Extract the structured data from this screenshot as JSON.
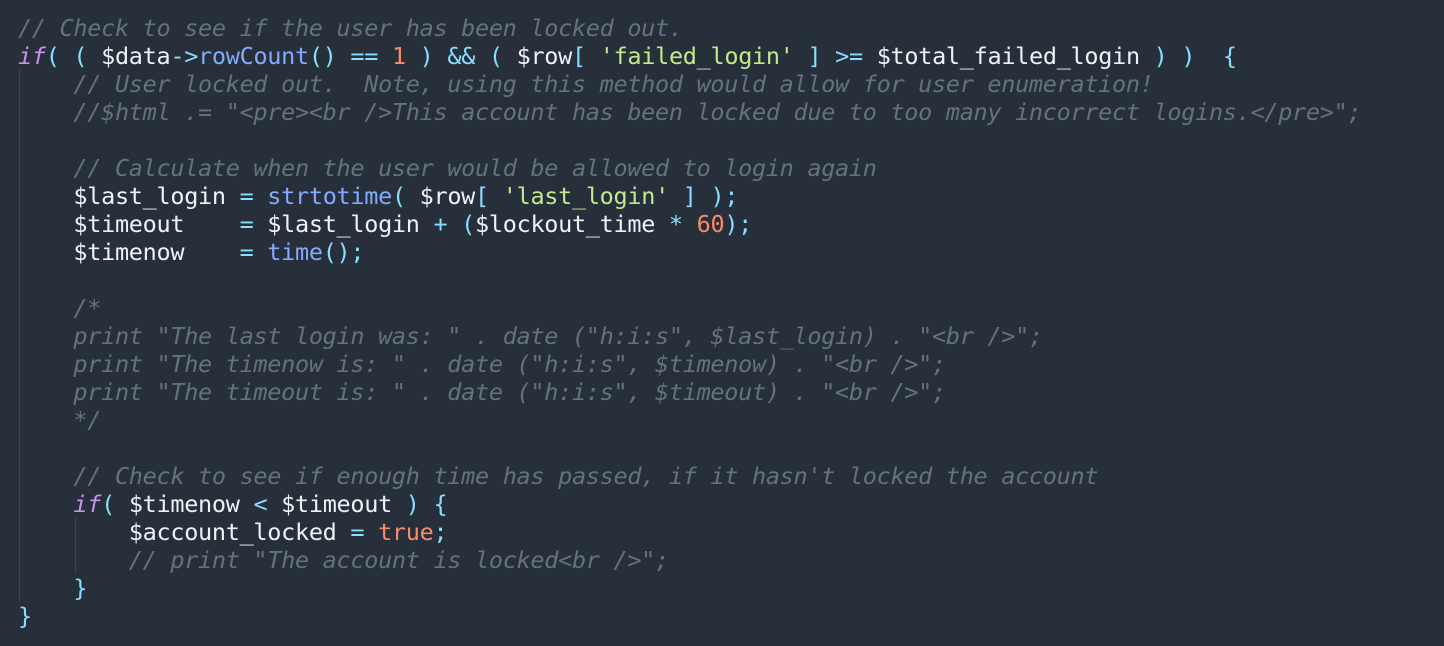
{
  "colors": {
    "background": "#27303a",
    "comment": "#63727f",
    "keyword": "#c792ea",
    "punctuation": "#89ddff",
    "variable": "#eef2f6",
    "function": "#82aaff",
    "number": "#f78c6c",
    "string": "#c3e88d",
    "boolean": "#f78c6c",
    "indent_guide": "#3a4552"
  },
  "code": {
    "lines": [
      {
        "indent": 0,
        "tokens": [
          {
            "t": "comment",
            "v": "// Check to see if the user has been locked out."
          }
        ]
      },
      {
        "indent": 0,
        "tokens": [
          {
            "t": "keyword",
            "v": "if"
          },
          {
            "t": "punct",
            "v": "( ( "
          },
          {
            "t": "var",
            "v": "$data"
          },
          {
            "t": "punct",
            "v": "->"
          },
          {
            "t": "func",
            "v": "rowCount"
          },
          {
            "t": "punct",
            "v": "() == "
          },
          {
            "t": "number",
            "v": "1"
          },
          {
            "t": "punct",
            "v": " ) && ( "
          },
          {
            "t": "var",
            "v": "$row"
          },
          {
            "t": "punct",
            "v": "[ "
          },
          {
            "t": "string",
            "v": "'failed_login'"
          },
          {
            "t": "punct",
            "v": " ] >= "
          },
          {
            "t": "var",
            "v": "$total_failed_login"
          },
          {
            "t": "punct",
            "v": " ) )  {"
          }
        ]
      },
      {
        "indent": 1,
        "tokens": [
          {
            "t": "comment",
            "v": "// User locked out.  Note, using this method would allow for user enumeration!"
          }
        ]
      },
      {
        "indent": 1,
        "tokens": [
          {
            "t": "comment",
            "v": "//$html .= \"<pre><br />This account has been locked due to too many incorrect logins.</pre>\";"
          }
        ]
      },
      {
        "indent": 1,
        "tokens": []
      },
      {
        "indent": 1,
        "tokens": [
          {
            "t": "comment",
            "v": "// Calculate when the user would be allowed to login again"
          }
        ]
      },
      {
        "indent": 1,
        "tokens": [
          {
            "t": "var",
            "v": "$last_login"
          },
          {
            "t": "punct",
            "v": " = "
          },
          {
            "t": "func",
            "v": "strtotime"
          },
          {
            "t": "punct",
            "v": "( "
          },
          {
            "t": "var",
            "v": "$row"
          },
          {
            "t": "punct",
            "v": "[ "
          },
          {
            "t": "string",
            "v": "'last_login'"
          },
          {
            "t": "punct",
            "v": " ] );"
          }
        ]
      },
      {
        "indent": 1,
        "tokens": [
          {
            "t": "var",
            "v": "$timeout"
          },
          {
            "t": "punct",
            "v": "    = "
          },
          {
            "t": "var",
            "v": "$last_login"
          },
          {
            "t": "punct",
            "v": " + ("
          },
          {
            "t": "var",
            "v": "$lockout_time"
          },
          {
            "t": "punct",
            "v": " * "
          },
          {
            "t": "number",
            "v": "60"
          },
          {
            "t": "punct",
            "v": ");"
          }
        ]
      },
      {
        "indent": 1,
        "tokens": [
          {
            "t": "var",
            "v": "$timenow"
          },
          {
            "t": "punct",
            "v": "    = "
          },
          {
            "t": "func",
            "v": "time"
          },
          {
            "t": "punct",
            "v": "();"
          }
        ]
      },
      {
        "indent": 1,
        "tokens": []
      },
      {
        "indent": 1,
        "tokens": [
          {
            "t": "comment",
            "v": "/*"
          }
        ]
      },
      {
        "indent": 1,
        "tokens": [
          {
            "t": "comment",
            "v": "print \"The last login was: \" . date (\"h:i:s\", $last_login) . \"<br />\";"
          }
        ]
      },
      {
        "indent": 1,
        "tokens": [
          {
            "t": "comment",
            "v": "print \"The timenow is: \" . date (\"h:i:s\", $timenow) . \"<br />\";"
          }
        ]
      },
      {
        "indent": 1,
        "tokens": [
          {
            "t": "comment",
            "v": "print \"The timeout is: \" . date (\"h:i:s\", $timeout) . \"<br />\";"
          }
        ]
      },
      {
        "indent": 1,
        "tokens": [
          {
            "t": "comment",
            "v": "*/"
          }
        ]
      },
      {
        "indent": 1,
        "tokens": []
      },
      {
        "indent": 1,
        "tokens": [
          {
            "t": "comment",
            "v": "// Check to see if enough time has passed, if it hasn't locked the account"
          }
        ]
      },
      {
        "indent": 1,
        "tokens": [
          {
            "t": "keyword",
            "v": "if"
          },
          {
            "t": "punct",
            "v": "( "
          },
          {
            "t": "var",
            "v": "$timenow"
          },
          {
            "t": "punct",
            "v": " < "
          },
          {
            "t": "var",
            "v": "$timeout"
          },
          {
            "t": "punct",
            "v": " ) {"
          }
        ]
      },
      {
        "indent": 2,
        "tokens": [
          {
            "t": "var",
            "v": "$account_locked"
          },
          {
            "t": "punct",
            "v": " = "
          },
          {
            "t": "bool",
            "v": "true"
          },
          {
            "t": "punct",
            "v": ";"
          }
        ]
      },
      {
        "indent": 2,
        "tokens": [
          {
            "t": "comment",
            "v": "// print \"The account is locked<br />\";"
          }
        ]
      },
      {
        "indent": 1,
        "tokens": [
          {
            "t": "punct",
            "v": "}"
          }
        ]
      },
      {
        "indent": 0,
        "tokens": [
          {
            "t": "punct",
            "v": "}"
          }
        ]
      }
    ]
  }
}
